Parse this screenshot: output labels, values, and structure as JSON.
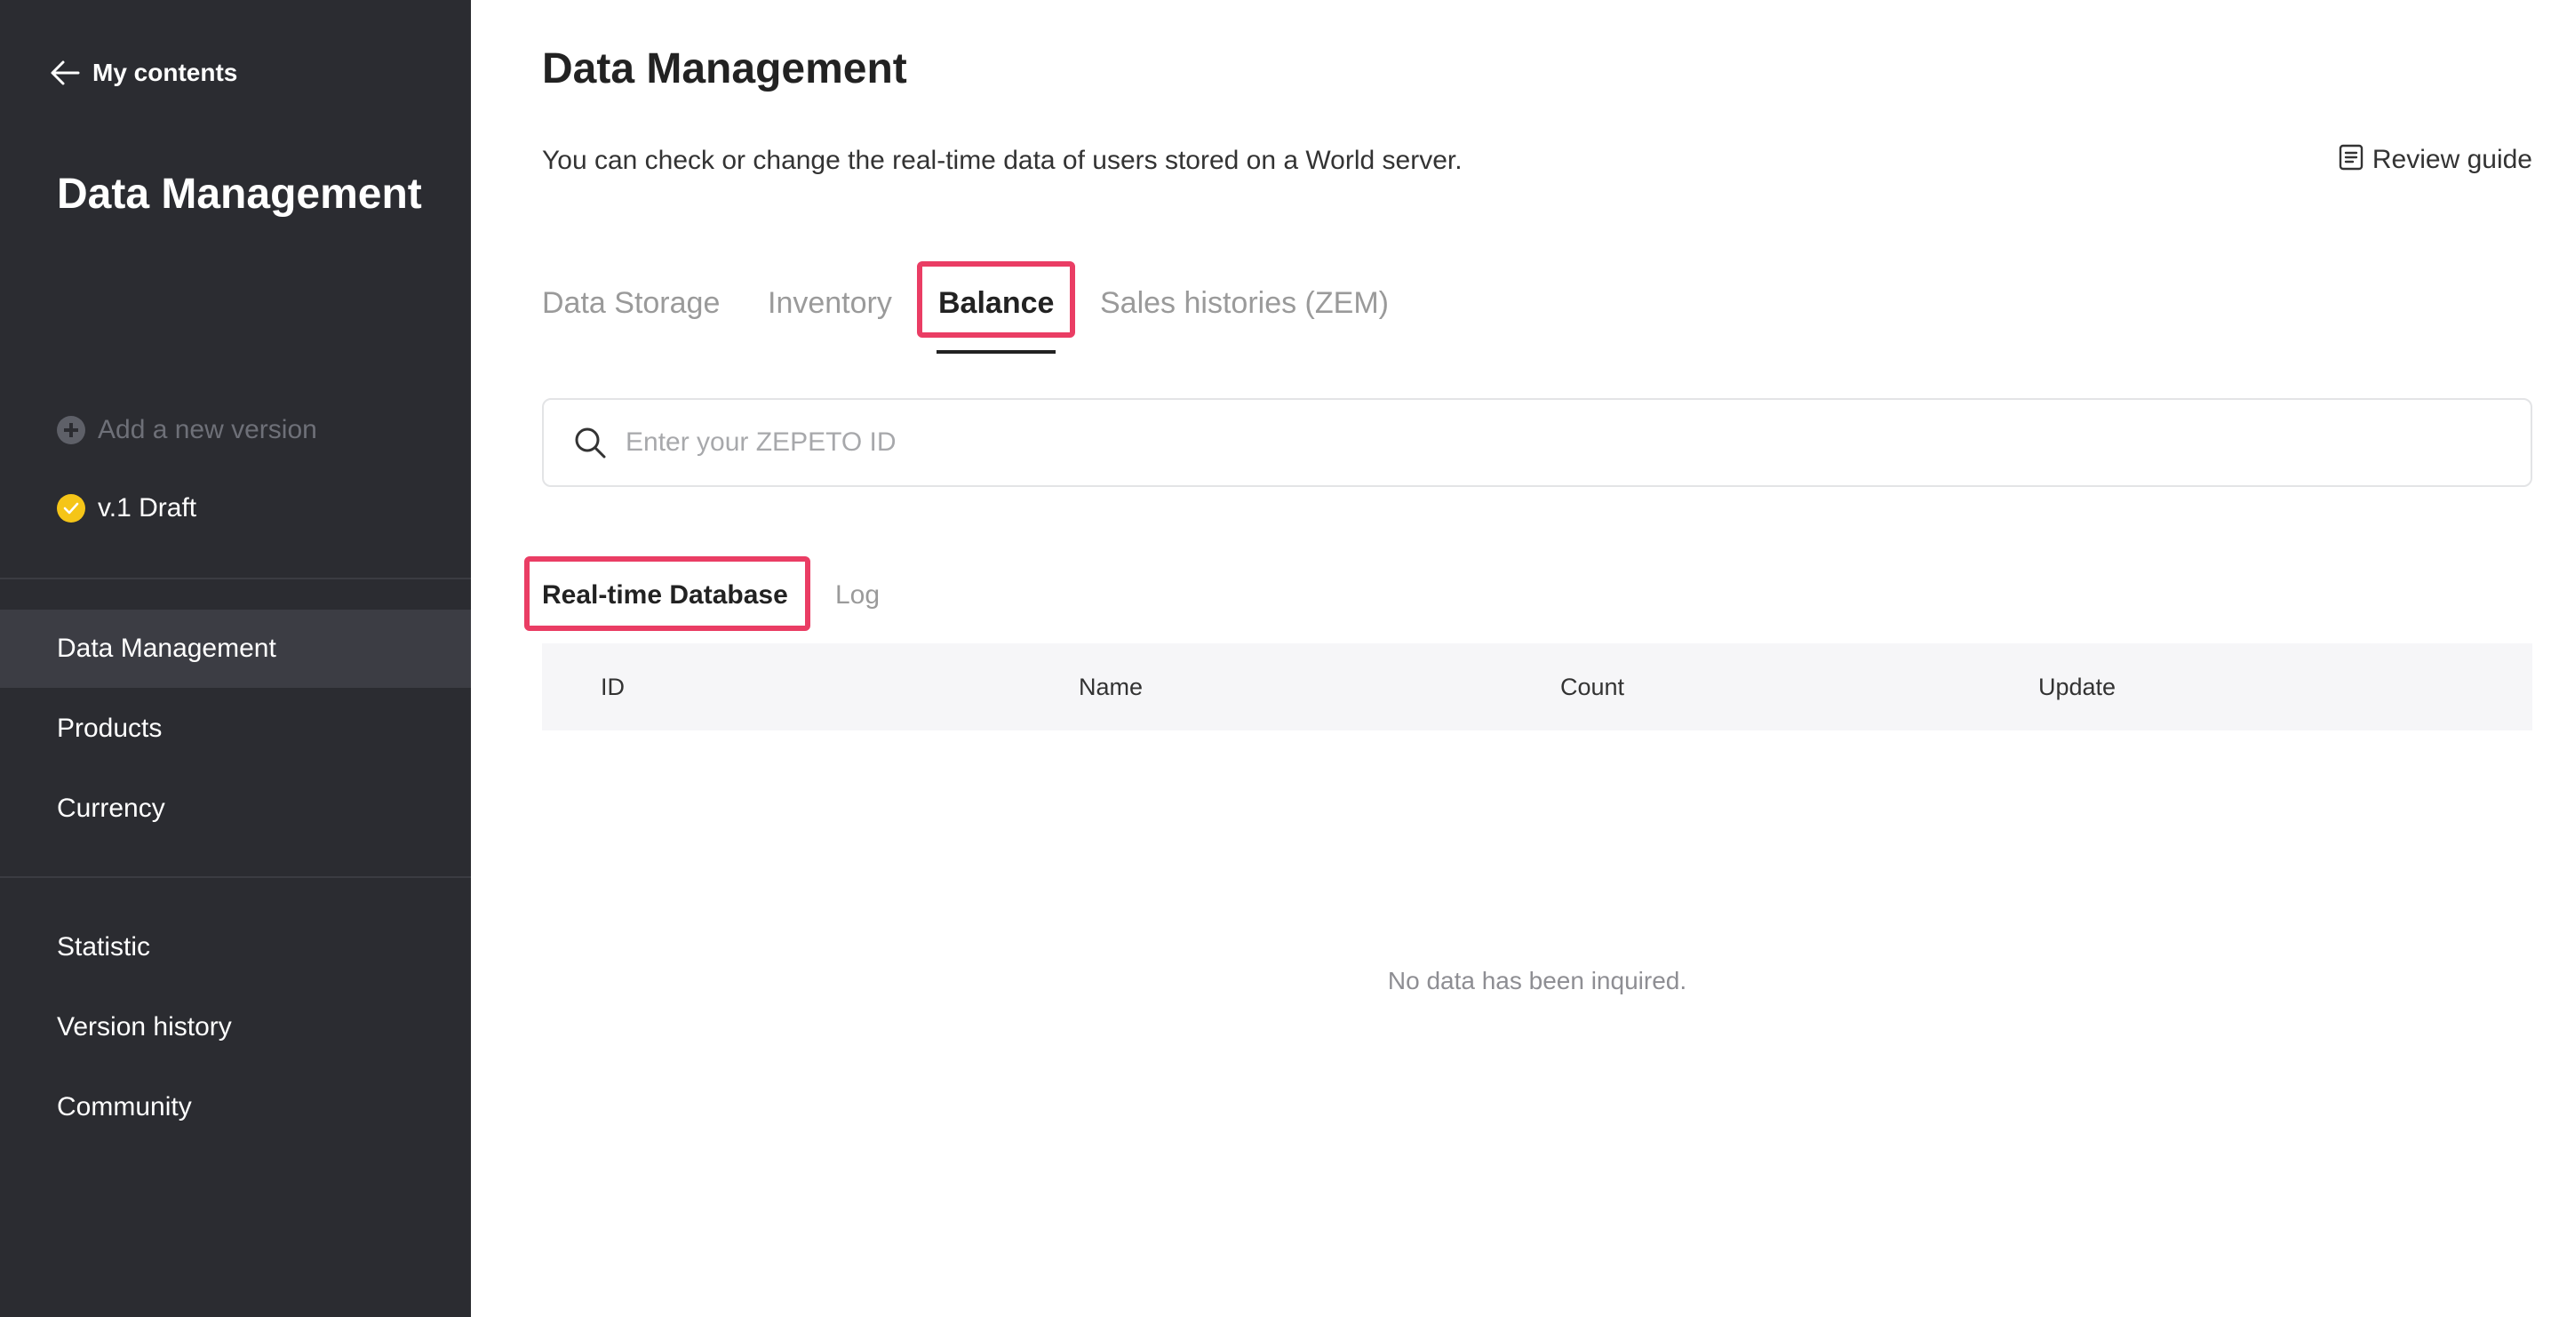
{
  "sidebar": {
    "back_label": "My contents",
    "title": "Data Management",
    "add_version_label": "Add a new version",
    "version_label": "v.1 Draft",
    "nav_group_1": [
      "Data Management",
      "Products",
      "Currency"
    ],
    "nav_group_2": [
      "Statistic",
      "Version history",
      "Community"
    ],
    "active_item": "Data Management"
  },
  "main": {
    "title": "Data Management",
    "description": "You can check or change the real-time data of users stored on a World server.",
    "review_guide_label": "Review guide",
    "tabs": [
      "Data Storage",
      "Inventory",
      "Balance",
      "Sales histories (ZEM)"
    ],
    "active_tab": "Balance",
    "search": {
      "placeholder": "Enter your ZEPETO ID",
      "value": ""
    },
    "subtabs": [
      "Real-time Database",
      "Log"
    ],
    "active_subtab": "Real-time Database",
    "table": {
      "columns": [
        "ID",
        "Name",
        "Count",
        "Update"
      ],
      "rows": [],
      "empty_message": "No data has been inquired."
    }
  },
  "colors": {
    "sidebar_bg": "#2b2c31",
    "sidebar_active_bg": "#3c3d44",
    "highlight": "#ea3d64",
    "version_badge": "#f5c518",
    "table_header_bg": "#f6f6f8"
  },
  "icons": {
    "back": "arrow-left-icon",
    "add_version": "plus-circle-icon",
    "version": "check-circle-icon",
    "review_guide": "document-icon",
    "search": "search-icon"
  }
}
